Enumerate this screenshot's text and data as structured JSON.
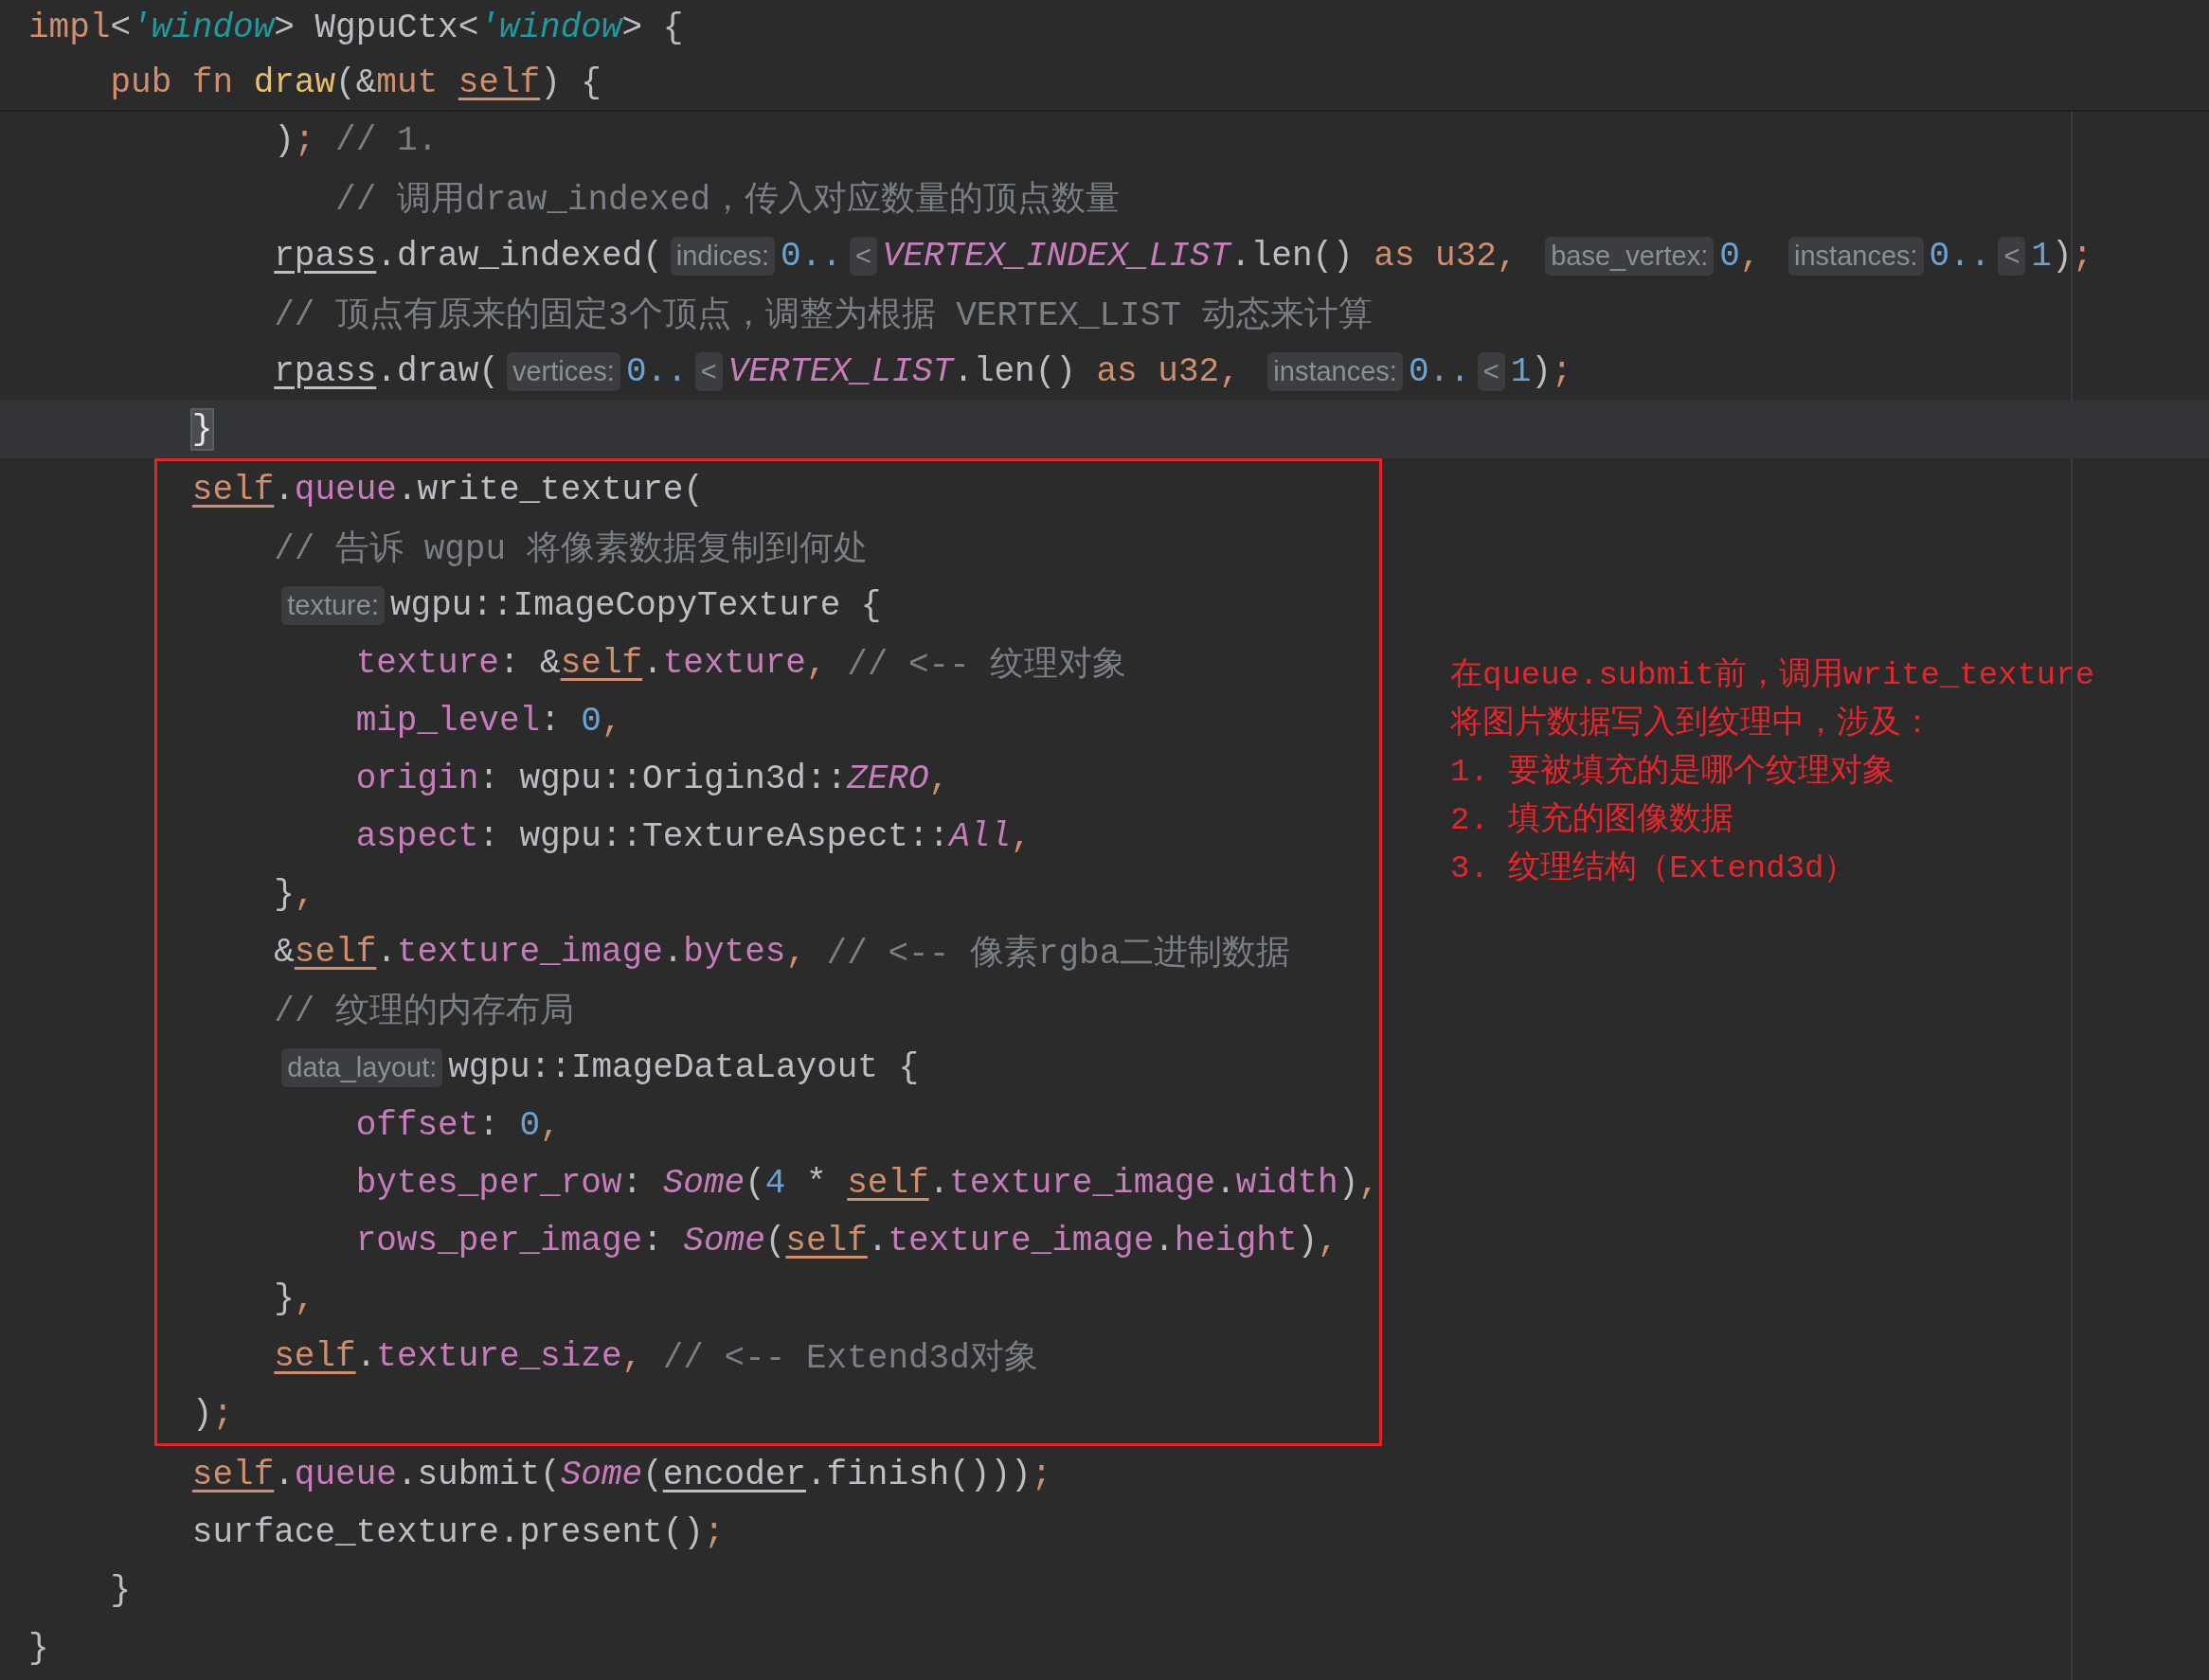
{
  "header_lines": [
    {
      "tokens": [
        {
          "kind": "kw",
          "text": "impl"
        },
        {
          "kind": "txt",
          "text": "<"
        },
        {
          "kind": "life",
          "text": "'window"
        },
        {
          "kind": "txt",
          "text": "> WgpuCtx<"
        },
        {
          "kind": "life",
          "text": "'window"
        },
        {
          "kind": "txt",
          "text": "> {"
        }
      ]
    },
    {
      "tokens": [
        {
          "kind": "kw",
          "text": "    pub fn "
        },
        {
          "kind": "fn",
          "text": "draw"
        },
        {
          "kind": "txt",
          "text": "(&"
        },
        {
          "kind": "kw",
          "text": "mut "
        },
        {
          "kind": "self",
          "text": "self"
        },
        {
          "kind": "txt",
          "text": ") {"
        }
      ]
    }
  ],
  "lines": [
    {
      "current": false,
      "boxed": false,
      "tokens": [
        {
          "kind": "txt",
          "text": "            )"
        },
        {
          "kind": "kw",
          "text": "; "
        },
        {
          "kind": "cm",
          "text": "// 1."
        }
      ]
    },
    {
      "current": false,
      "boxed": false,
      "tokens": [
        {
          "kind": "cm",
          "text": "               // 调用draw_indexed，传入对应数量的顶点数量"
        }
      ]
    },
    {
      "current": false,
      "boxed": false,
      "tokens": [
        {
          "kind": "ul",
          "text": "            rpass"
        },
        {
          "kind": "txt",
          "text": ".draw_indexed("
        },
        {
          "kind": "hint",
          "text": "indices:"
        },
        {
          "kind": "num",
          "text": "0.."
        },
        {
          "kind": "hint",
          "text": "<"
        },
        {
          "kind": "const",
          "text": "VERTEX_INDEX_LIST"
        },
        {
          "kind": "txt",
          "text": ".len() "
        },
        {
          "kind": "kw",
          "text": "as u32, "
        },
        {
          "kind": "hint",
          "text": "base_vertex:"
        },
        {
          "kind": "num",
          "text": "0"
        },
        {
          "kind": "kw",
          "text": ", "
        },
        {
          "kind": "hint",
          "text": "instances:"
        },
        {
          "kind": "num",
          "text": "0.."
        },
        {
          "kind": "hint",
          "text": "<"
        },
        {
          "kind": "num",
          "text": "1"
        },
        {
          "kind": "txt",
          "text": ")"
        },
        {
          "kind": "kw",
          "text": ";"
        }
      ]
    },
    {
      "current": false,
      "boxed": false,
      "tokens": [
        {
          "kind": "cm",
          "text": "            // 顶点有原来的固定3个顶点，调整为根据 VERTEX_LIST 动态来计算"
        }
      ]
    },
    {
      "current": false,
      "boxed": false,
      "tokens": [
        {
          "kind": "ul",
          "text": "            rpass"
        },
        {
          "kind": "txt",
          "text": ".draw("
        },
        {
          "kind": "hint",
          "text": "vertices:"
        },
        {
          "kind": "num",
          "text": "0.."
        },
        {
          "kind": "hint",
          "text": "<"
        },
        {
          "kind": "const",
          "text": "VERTEX_LIST"
        },
        {
          "kind": "txt",
          "text": ".len() "
        },
        {
          "kind": "kw",
          "text": "as u32, "
        },
        {
          "kind": "hint",
          "text": "instances:"
        },
        {
          "kind": "num",
          "text": "0.."
        },
        {
          "kind": "hint",
          "text": "<"
        },
        {
          "kind": "num",
          "text": "1"
        },
        {
          "kind": "txt",
          "text": ")"
        },
        {
          "kind": "kw",
          "text": ";"
        }
      ]
    },
    {
      "current": true,
      "boxed": false,
      "tokens": [
        {
          "kind": "brace",
          "text": "        }"
        }
      ]
    },
    {
      "current": false,
      "boxed": true,
      "tokens": [
        {
          "kind": "self",
          "text": "        self"
        },
        {
          "kind": "txt",
          "text": "."
        },
        {
          "kind": "field",
          "text": "queue"
        },
        {
          "kind": "txt",
          "text": ".write_texture("
        }
      ]
    },
    {
      "current": false,
      "boxed": true,
      "tokens": [
        {
          "kind": "cm",
          "text": "            // 告诉 wgpu 将像素数据复制到何处"
        }
      ]
    },
    {
      "current": false,
      "boxed": true,
      "tokens": [
        {
          "kind": "hint",
          "text": "            texture:"
        },
        {
          "kind": "txt",
          "text": "wgpu::ImageCopyTexture {"
        }
      ]
    },
    {
      "current": false,
      "boxed": true,
      "tokens": [
        {
          "kind": "field",
          "text": "                texture"
        },
        {
          "kind": "txt",
          "text": ": &"
        },
        {
          "kind": "self",
          "text": "self"
        },
        {
          "kind": "txt",
          "text": "."
        },
        {
          "kind": "field",
          "text": "texture"
        },
        {
          "kind": "kw",
          "text": ", "
        },
        {
          "kind": "cm",
          "text": "// <-- 纹理对象"
        }
      ]
    },
    {
      "current": false,
      "boxed": true,
      "tokens": [
        {
          "kind": "field",
          "text": "                mip_level"
        },
        {
          "kind": "txt",
          "text": ": "
        },
        {
          "kind": "num",
          "text": "0"
        },
        {
          "kind": "kw",
          "text": ","
        }
      ]
    },
    {
      "current": false,
      "boxed": true,
      "tokens": [
        {
          "kind": "field",
          "text": "                origin"
        },
        {
          "kind": "txt",
          "text": ": wgpu::Origin3d::"
        },
        {
          "kind": "const",
          "text": "ZERO"
        },
        {
          "kind": "kw",
          "text": ","
        }
      ]
    },
    {
      "current": false,
      "boxed": true,
      "tokens": [
        {
          "kind": "field",
          "text": "                aspect"
        },
        {
          "kind": "txt",
          "text": ": wgpu::TextureAspect::"
        },
        {
          "kind": "const",
          "text": "All"
        },
        {
          "kind": "kw",
          "text": ","
        }
      ]
    },
    {
      "current": false,
      "boxed": true,
      "tokens": [
        {
          "kind": "txt",
          "text": "            }"
        },
        {
          "kind": "kw",
          "text": ","
        }
      ]
    },
    {
      "current": false,
      "boxed": true,
      "tokens": [
        {
          "kind": "txt",
          "text": "            &"
        },
        {
          "kind": "self",
          "text": "self"
        },
        {
          "kind": "txt",
          "text": "."
        },
        {
          "kind": "field",
          "text": "texture_image"
        },
        {
          "kind": "txt",
          "text": "."
        },
        {
          "kind": "field",
          "text": "bytes"
        },
        {
          "kind": "kw",
          "text": ", "
        },
        {
          "kind": "cm",
          "text": "// <-- 像素rgba二进制数据"
        }
      ]
    },
    {
      "current": false,
      "boxed": true,
      "tokens": [
        {
          "kind": "cm",
          "text": "            // 纹理的内存布局"
        }
      ]
    },
    {
      "current": false,
      "boxed": true,
      "tokens": [
        {
          "kind": "hint",
          "text": "            data_layout:"
        },
        {
          "kind": "txt",
          "text": "wgpu::ImageDataLayout {"
        }
      ]
    },
    {
      "current": false,
      "boxed": true,
      "tokens": [
        {
          "kind": "field",
          "text": "                offset"
        },
        {
          "kind": "txt",
          "text": ": "
        },
        {
          "kind": "num",
          "text": "0"
        },
        {
          "kind": "kw",
          "text": ","
        }
      ]
    },
    {
      "current": false,
      "boxed": true,
      "tokens": [
        {
          "kind": "field",
          "text": "                bytes_per_row"
        },
        {
          "kind": "txt",
          "text": ": "
        },
        {
          "kind": "const",
          "text": "Some"
        },
        {
          "kind": "txt",
          "text": "("
        },
        {
          "kind": "num",
          "text": "4"
        },
        {
          "kind": "txt",
          "text": " * "
        },
        {
          "kind": "self",
          "text": "self"
        },
        {
          "kind": "txt",
          "text": "."
        },
        {
          "kind": "field",
          "text": "texture_image"
        },
        {
          "kind": "txt",
          "text": "."
        },
        {
          "kind": "field",
          "text": "width"
        },
        {
          "kind": "txt",
          "text": ")"
        },
        {
          "kind": "kw",
          "text": ","
        }
      ]
    },
    {
      "current": false,
      "boxed": true,
      "tokens": [
        {
          "kind": "field",
          "text": "                rows_per_image"
        },
        {
          "kind": "txt",
          "text": ": "
        },
        {
          "kind": "const",
          "text": "Some"
        },
        {
          "kind": "txt",
          "text": "("
        },
        {
          "kind": "self",
          "text": "self"
        },
        {
          "kind": "txt",
          "text": "."
        },
        {
          "kind": "field",
          "text": "texture_image"
        },
        {
          "kind": "txt",
          "text": "."
        },
        {
          "kind": "field",
          "text": "height"
        },
        {
          "kind": "txt",
          "text": ")"
        },
        {
          "kind": "kw",
          "text": ","
        }
      ]
    },
    {
      "current": false,
      "boxed": true,
      "tokens": [
        {
          "kind": "txt",
          "text": "            }"
        },
        {
          "kind": "kw",
          "text": ","
        }
      ]
    },
    {
      "current": false,
      "boxed": true,
      "tokens": [
        {
          "kind": "self",
          "text": "            self"
        },
        {
          "kind": "txt",
          "text": "."
        },
        {
          "kind": "field",
          "text": "texture_size"
        },
        {
          "kind": "kw",
          "text": ", "
        },
        {
          "kind": "cm",
          "text": "// <-- Extend3d对象"
        }
      ]
    },
    {
      "current": false,
      "boxed": true,
      "tokens": [
        {
          "kind": "txt",
          "text": "        )"
        },
        {
          "kind": "kw",
          "text": ";"
        }
      ]
    },
    {
      "current": false,
      "boxed": false,
      "tokens": [
        {
          "kind": "self",
          "text": "        self"
        },
        {
          "kind": "txt",
          "text": "."
        },
        {
          "kind": "field",
          "text": "queue"
        },
        {
          "kind": "txt",
          "text": ".submit("
        },
        {
          "kind": "const",
          "text": "Some"
        },
        {
          "kind": "txt",
          "text": "("
        },
        {
          "kind": "ul",
          "text": "encoder"
        },
        {
          "kind": "txt",
          "text": ".finish()))"
        },
        {
          "kind": "kw",
          "text": ";"
        }
      ]
    },
    {
      "current": false,
      "boxed": false,
      "tokens": [
        {
          "kind": "txt",
          "text": "        surface_texture.present()"
        },
        {
          "kind": "kw",
          "text": ";"
        }
      ]
    },
    {
      "current": false,
      "boxed": false,
      "tokens": [
        {
          "kind": "txt",
          "text": "    }"
        }
      ]
    },
    {
      "current": false,
      "boxed": false,
      "tokens": [
        {
          "kind": "txt",
          "text": "}"
        }
      ]
    }
  ],
  "annotation": [
    "在queue.submit前，调用write_texture",
    "将图片数据写入到纹理中，涉及：",
    "1. 要被填充的是哪个纹理对象",
    "2. 填充的图像数据",
    "3. 纹理结构（Extend3d）"
  ]
}
